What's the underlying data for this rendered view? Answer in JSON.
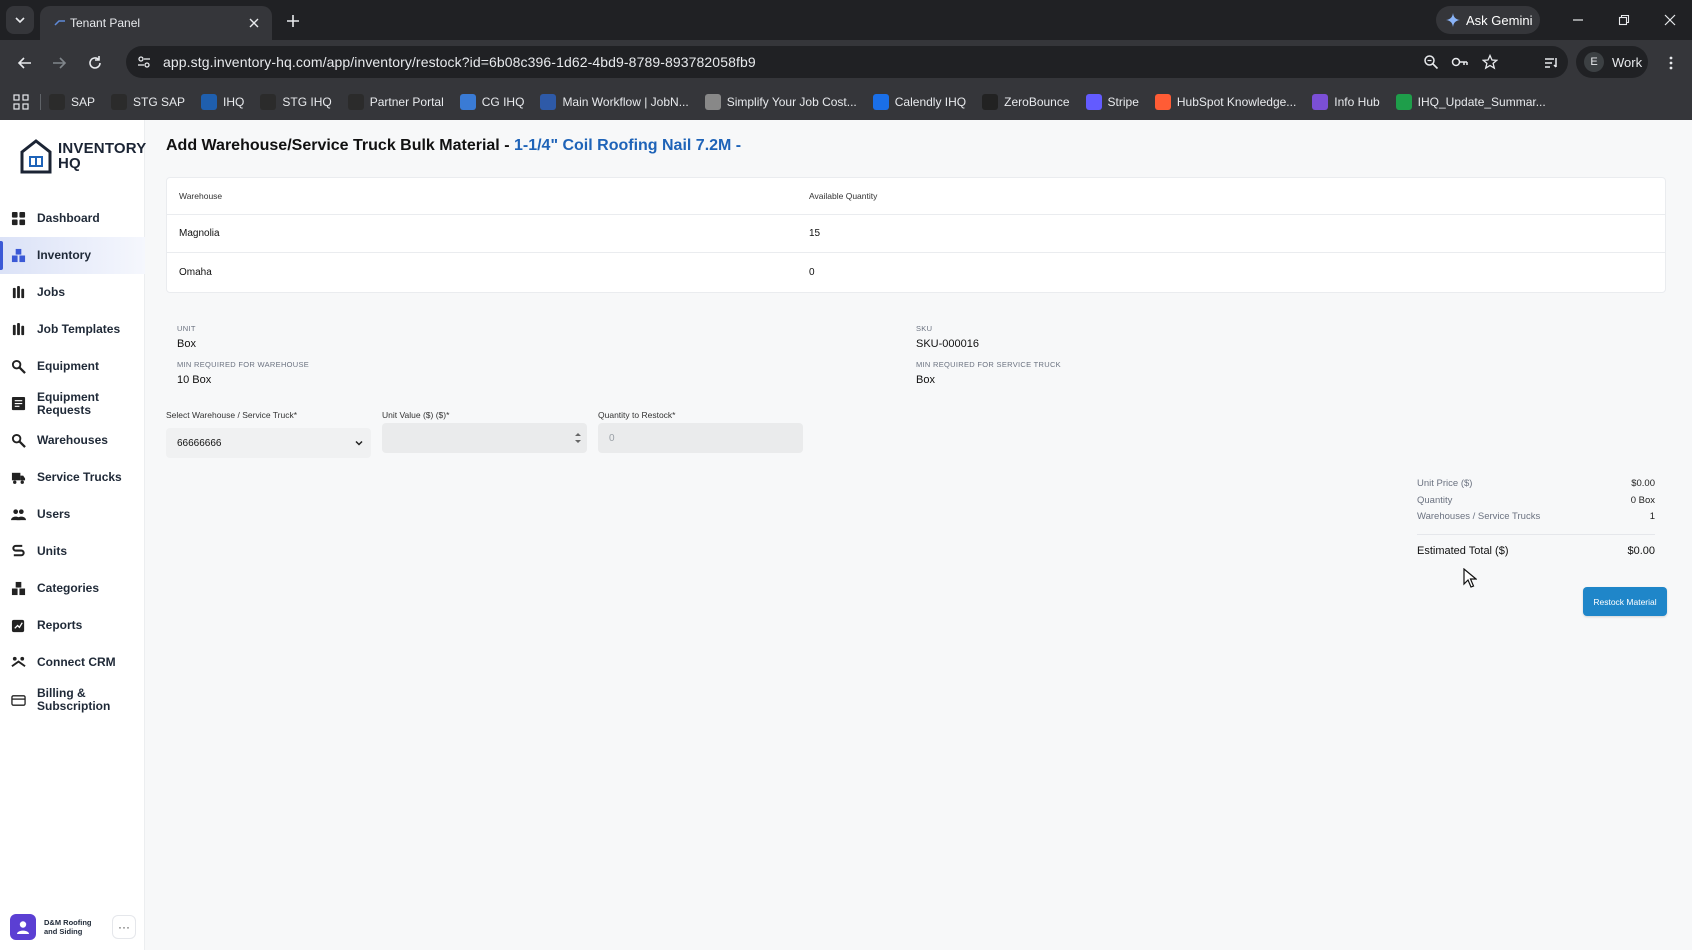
{
  "browser": {
    "tab_title": "Tenant Panel",
    "gemini_label": "Ask Gemini",
    "url": "app.stg.inventory-hq.com/app/inventory/restock?id=6b08c396-1d62-4bd9-8789-893782058fb9",
    "profile_initial": "E",
    "profile_label": "Work",
    "bookmarks": [
      {
        "label": "SAP",
        "color": "#2b2b2b"
      },
      {
        "label": "STG SAP",
        "color": "#2b2b2b"
      },
      {
        "label": "IHQ",
        "color": "#1f5fae"
      },
      {
        "label": "STG IHQ",
        "color": "#2b2b2b"
      },
      {
        "label": "Partner Portal",
        "color": "#2b2b2b"
      },
      {
        "label": "CG IHQ",
        "color": "#3a7bd5"
      },
      {
        "label": "Main Workflow | JobN...",
        "color": "#2e5aa8"
      },
      {
        "label": "Simplify Your Job Cost...",
        "color": "#888888"
      },
      {
        "label": "Calendly IHQ",
        "color": "#1a6fe8"
      },
      {
        "label": "ZeroBounce",
        "color": "#222222"
      },
      {
        "label": "Stripe",
        "color": "#635bff"
      },
      {
        "label": "HubSpot Knowledge...",
        "color": "#ff5c35"
      },
      {
        "label": "Info Hub",
        "color": "#7b4fd6"
      },
      {
        "label": "IHQ_Update_Summar...",
        "color": "#1e9e4a"
      }
    ]
  },
  "sidebar": {
    "logo_line1": "INVENTORY",
    "logo_line2": "HQ",
    "items": [
      {
        "label": "Dashboard",
        "icon": "dashboard-icon"
      },
      {
        "label": "Inventory",
        "icon": "inventory-icon",
        "active": true
      },
      {
        "label": "Jobs",
        "icon": "jobs-icon"
      },
      {
        "label": "Job Templates",
        "icon": "job-templates-icon"
      },
      {
        "label": "Equipment",
        "icon": "equipment-icon"
      },
      {
        "label": "Equipment Requests",
        "icon": "equipment-requests-icon"
      },
      {
        "label": "Warehouses",
        "icon": "warehouses-icon"
      },
      {
        "label": "Service Trucks",
        "icon": "truck-icon"
      },
      {
        "label": "Users",
        "icon": "users-icon"
      },
      {
        "label": "Units",
        "icon": "units-icon"
      },
      {
        "label": "Categories",
        "icon": "categories-icon"
      },
      {
        "label": "Reports",
        "icon": "reports-icon"
      },
      {
        "label": "Connect CRM",
        "icon": "crm-icon"
      },
      {
        "label": "Billing & Subscription",
        "icon": "billing-icon"
      }
    ],
    "tenant_name": "D&M Roofing and Siding",
    "tenant_more": "···"
  },
  "page": {
    "title_prefix": "Add Warehouse/Service Truck Bulk Material - ",
    "title_material": "1-1/4\" Coil Roofing Nail 7.2M -",
    "table": {
      "headers": [
        "Warehouse",
        "Available Quantity"
      ],
      "rows": [
        [
          "Magnolia",
          "15"
        ],
        [
          "Omaha",
          "0"
        ]
      ]
    },
    "info": {
      "unit_label": "UNIT",
      "unit_value": "Box",
      "min_warehouse_label": "MIN REQUIRED FOR WAREHOUSE",
      "min_warehouse_value": "10 Box",
      "sku_label": "SKU",
      "sku_value": "SKU-000016",
      "min_truck_label": "MIN REQUIRED FOR SERVICE TRUCK",
      "min_truck_value": "Box"
    },
    "form": {
      "select_label": "Select Warehouse / Service Truck*",
      "select_value": "66666666",
      "unit_value_label": "Unit Value ($) ($)*",
      "unit_value_value": "",
      "qty_label": "Quantity to Restock*",
      "qty_placeholder": "0"
    },
    "summary": {
      "unit_price_label": "Unit Price ($)",
      "unit_price_value": "$0.00",
      "quantity_label": "Quantity",
      "quantity_value": "0 Box",
      "locations_label": "Warehouses / Service Trucks",
      "locations_value": "1",
      "total_label": "Estimated Total ($)",
      "total_value": "$0.00"
    },
    "restock_button": "Restock Material"
  }
}
